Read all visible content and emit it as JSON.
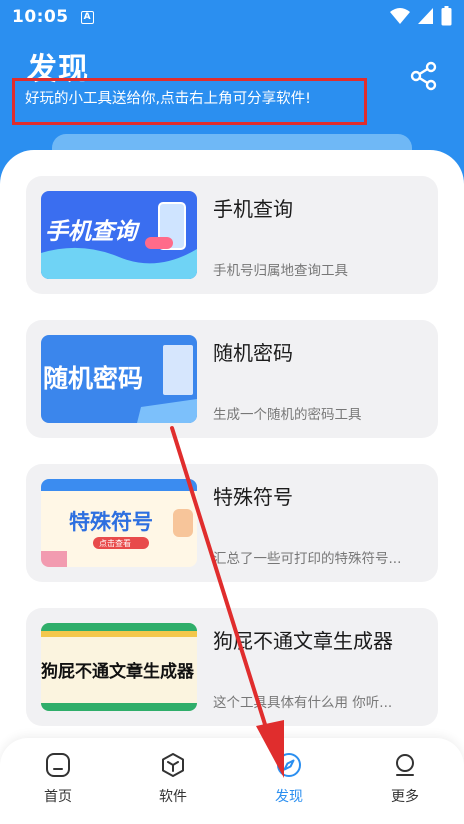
{
  "status": {
    "time": "10:05",
    "notif_glyph": "A"
  },
  "header": {
    "title": "发现",
    "subtitle": "好玩的小工具送给你,点击右上角可分享软件!"
  },
  "cards": [
    {
      "title": "手机查询",
      "desc": "手机号归属地查询工具",
      "thumb_text": "手机查询"
    },
    {
      "title": "随机密码",
      "desc": "生成一个随机的密码工具",
      "thumb_text": "随机密码"
    },
    {
      "title": "特殊符号",
      "desc": "汇总了一些可打印的特殊符号...",
      "thumb_text": "特殊符号",
      "thumb_sub": "点击查看"
    },
    {
      "title": "狗屁不通文章生成器",
      "desc": "这个工具具体有什么用 你听...",
      "thumb_text": "狗屁不通文章生成器"
    }
  ],
  "nav": {
    "items": [
      {
        "label": "首页",
        "icon": "home-icon"
      },
      {
        "label": "软件",
        "icon": "cube-icon"
      },
      {
        "label": "发现",
        "icon": "compass-icon"
      },
      {
        "label": "更多",
        "icon": "person-icon"
      }
    ],
    "active_index": 2
  },
  "colors": {
    "primary": "#2b8ff0",
    "highlight_box": "#e02d2d",
    "annotation_arrow": "#e02d2d"
  }
}
